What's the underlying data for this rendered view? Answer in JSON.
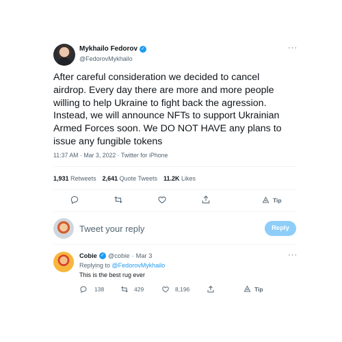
{
  "tweet": {
    "author_name": "Mykhailo Fedorov",
    "author_handle": "@FedorovMykhailo",
    "text": "After careful consideration we decided to cancel airdrop. Every day there are more and more people willing to help Ukraine to fight back the agression. Instead, we will announce NFTs to support Ukrainian Armed Forces soon. We DO NOT HAVE any plans to issue any fungible tokens",
    "time": "11:37 AM · Mar 3, 2022 · Twitter for iPhone",
    "more_icon": "···",
    "stats": [
      {
        "count": "1,931",
        "label": "Retweets"
      },
      {
        "count": "2,641",
        "label": "Quote Tweets"
      },
      {
        "count": "11.2K",
        "label": "Likes"
      }
    ],
    "actions": {
      "reply_icon": "reply-icon",
      "retweet_icon": "retweet-icon",
      "like_icon": "heart-icon",
      "share_icon": "share-icon",
      "tip_label": "Tip"
    }
  },
  "compose": {
    "placeholder": "Tweet your reply",
    "reply_button": "Reply"
  },
  "reply": {
    "author_name": "Cobie",
    "author_handle": "@cobie",
    "separator": "·",
    "date": "Mar 3",
    "replying_prefix": "Replying to",
    "replying_to": "@FedorovMykhailo",
    "text": "This is the best rug ever",
    "more_icon": "···",
    "replies": "138",
    "retweets": "429",
    "likes": "8,196",
    "tip_label": "Tip"
  },
  "colors": {
    "accent": "#1d9bf0",
    "text": "#0f1419",
    "muted": "#536471",
    "reply_button_disabled": "#8ecdf8",
    "divider": "#eff3f4"
  }
}
